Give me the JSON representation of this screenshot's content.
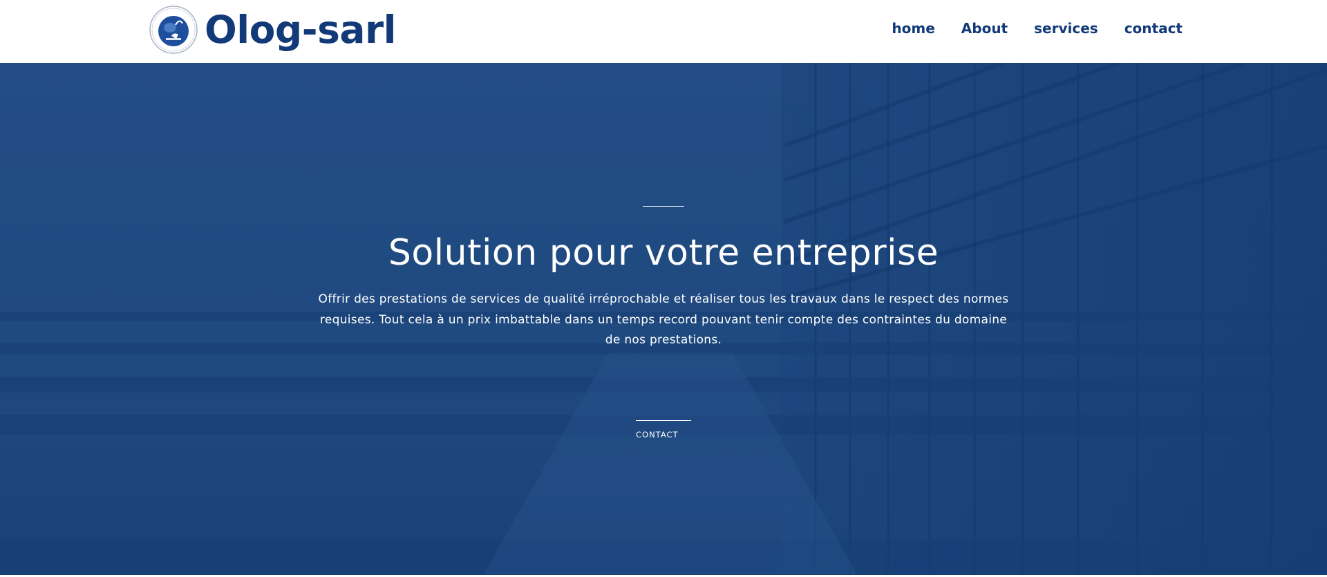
{
  "brand": {
    "name": "Olog-sarl",
    "logo_text": "Olog sarl"
  },
  "nav": {
    "items": [
      {
        "label": "home"
      },
      {
        "label": "About"
      },
      {
        "label": "services"
      },
      {
        "label": "contact"
      }
    ]
  },
  "hero": {
    "title": "Solution pour votre entreprise",
    "description": "Offrir des prestations de services de qualité irréprochable et réaliser tous les travaux dans le respect des normes requises. Tout cela à un prix imbattable dans un temps record pouvant tenir compte des contraintes du domaine de nos prestations.",
    "cta_label": "CONTACT"
  },
  "colors": {
    "brand_blue": "#123a78",
    "hero_overlay": "#204a80",
    "text_on_hero": "#ffffff"
  },
  "icons": {
    "logo": "globe-logo-icon",
    "background": "building-glass-facade"
  }
}
